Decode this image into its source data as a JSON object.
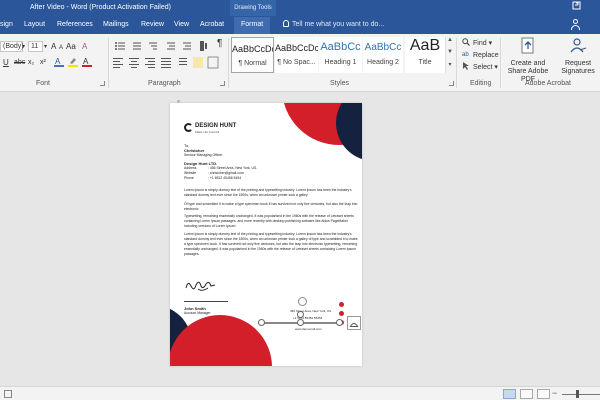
{
  "titlebar": {
    "doc_title": "After Video - Word (Product Activation Failed)",
    "contextual_tools": "Drawing Tools",
    "window_icon": "restore-icon"
  },
  "tabs": {
    "items": [
      "sign",
      "Layout",
      "References",
      "Mailings",
      "Review",
      "View",
      "Acrobat",
      "Format"
    ],
    "active": "Format",
    "tell_me": "Tell me what you want to do..."
  },
  "ribbon": {
    "font": {
      "name": "(Body)",
      "size": "11",
      "group_label": "Font",
      "row2": [
        "U",
        "abc",
        "x₂",
        "x²",
        "A",
        "A"
      ],
      "row1": [
        "A",
        "A",
        "Aa",
        "A"
      ]
    },
    "paragraph": {
      "group_label": "Paragraph",
      "pilcrow": "¶"
    },
    "styles": {
      "group_label": "Styles",
      "items": [
        {
          "preview": "AaBbCcDc",
          "name": "¶ Normal"
        },
        {
          "preview": "AaBbCcDc",
          "name": "¶ No Spac..."
        },
        {
          "preview": "AaBbCc",
          "name": "Heading 1"
        },
        {
          "preview": "AaBbCc",
          "name": "Heading 2"
        },
        {
          "preview": "AaB",
          "name": "Title"
        }
      ]
    },
    "editing": {
      "group_label": "Editing",
      "find": "Find",
      "replace": "Replace",
      "select": "Select"
    },
    "acrobat": {
      "group_label": "Adobe Acrobat",
      "create_share": "Create and Share Adobe PDF",
      "request_sig": "Request Signatures"
    }
  },
  "document": {
    "company": "DESIGN HUNT",
    "tagline": "Make Life Colorful",
    "to": "To,",
    "recipient": "Christoher",
    "recipient_title": "Seniour Managing Officer",
    "org": "Design Hunt LTD.",
    "address_label": "Address",
    "address_value": ": 456 Street Area, New York, US.",
    "website_label": "Website",
    "website_value": ": christoher@gmail.com",
    "phone_label": "Phone",
    "phone_value": ": +1 6512 45456 5454",
    "para1": "Lorem Ipsum is simply dummy text of the printing and typesetting industry. Lorem Ipsum has been the industry's standard dummy text ever since the 1500s, when an unknown printer took a galley",
    "para2": "Of type and scrambled it to make a type specimen book It has survived not only five centuries, but also the leap into electronic",
    "para3": "Typesetting, remaining essentially unchanged. It was popularised in the 1960s with the release of Letraset sheets containing Lorem Ipsum passages, and more recently with desktop publishing software like Aldus PageMaker including versions of Lorem Ipsum",
    "para4": "Lorem Ipsum is simply dummy text of the printing and typesetting industry. Lorem Ipsum has been the industry's standard dummy text ever since the 1500s, when an unknown printer took a galley of type and scrambled it to make a type specimen book. It has survived not only five centuries, but also the leap into electronic typesetting, remaining essentially unchanged. It was popularised in the 1960s with the release of Letraset sheets containing Lorem Ipsum passages.",
    "signer": "John Smith",
    "signer_title": "Account Manager",
    "contact_address": "456 Street Area, New York, US.",
    "contact_phone": "+1 5454 55454 55454",
    "contact_web": "www.demomail.com"
  },
  "colors": {
    "brand_blue": "#2b579a",
    "accent_red": "#d31f29",
    "navy": "#15223f"
  }
}
